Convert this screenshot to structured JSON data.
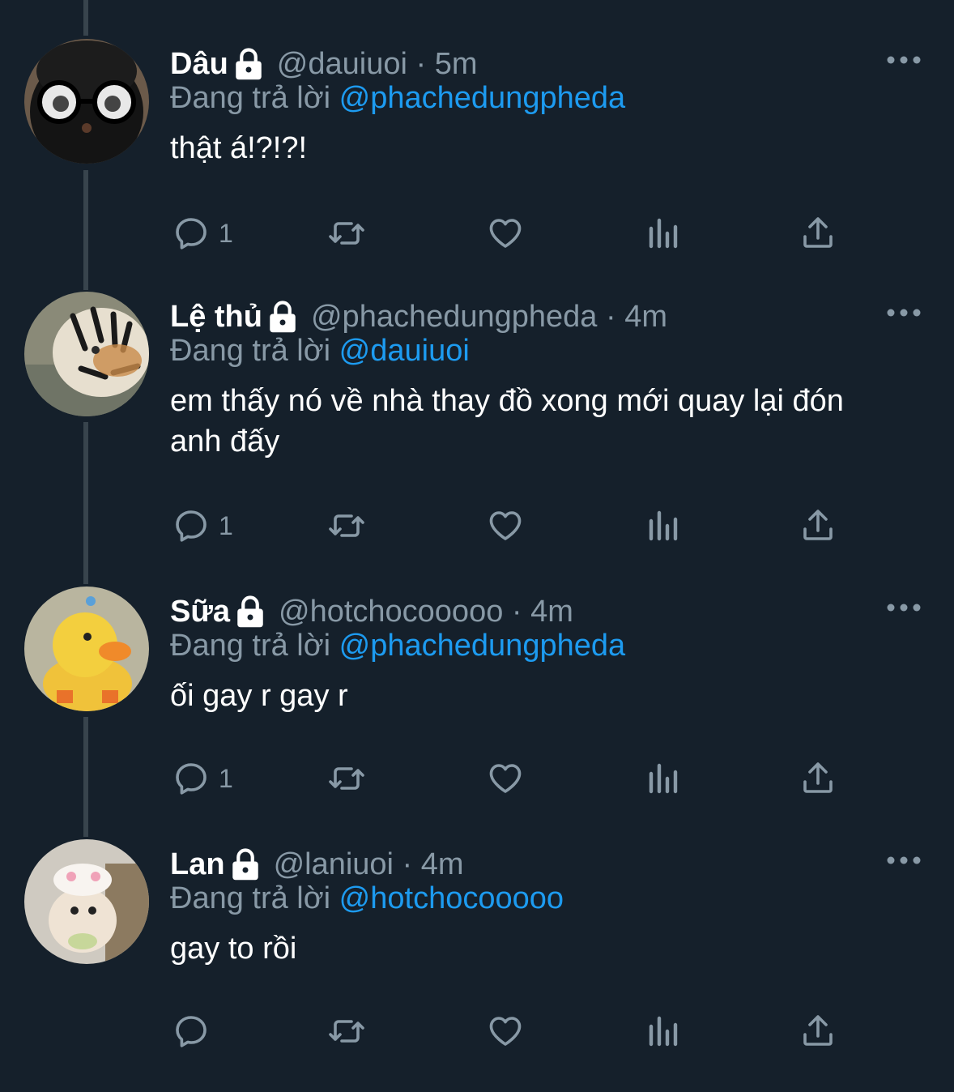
{
  "theme": {
    "background": "#15202b",
    "secondary_text": "#8899a6",
    "accent": "#1d9bf0",
    "thread_line": "#38444d"
  },
  "replying_label": "Đang trả lời",
  "tweets": [
    {
      "name": "Dâu",
      "handle": "@dauiuoi",
      "time": "5m",
      "replying_to": "@phachedungpheda",
      "text": "thật á!?!?!",
      "reply_count": "1",
      "avatar": "avatar-black-plush-glasses"
    },
    {
      "name": "Lệ thủ",
      "handle": "@phachedungpheda",
      "time": "4m",
      "replying_to": "@dauiuoi",
      "text": "em thấy nó về nhà thay đồ xong mới quay lại đón anh đấy",
      "reply_count": "1",
      "avatar": "avatar-tiger"
    },
    {
      "name": "Sữa",
      "handle": "@hotchocooooo",
      "time": "4m",
      "replying_to": "@phachedungpheda",
      "text": "ối gay r gay r",
      "reply_count": "1",
      "avatar": "avatar-yellow-duck"
    },
    {
      "name": "Lan",
      "handle": "@laniuoi",
      "time": "4m",
      "replying_to": "@hotchocooooo",
      "text": "gay to rồi",
      "reply_count": "",
      "avatar": "avatar-hamster"
    }
  ]
}
